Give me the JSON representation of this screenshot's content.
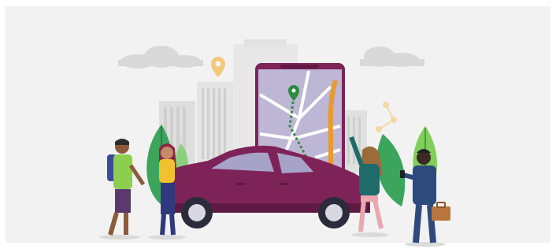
{
  "scene": {
    "description_tag": "ride-share-illustration",
    "colors": {
      "panel": "#f2f2f2",
      "car": "#7e2358",
      "car_dark": "#5e1a43",
      "phone_screen": "#bcb5d2",
      "phone_frame": "#7e2358",
      "route_green": "#2e8b3e",
      "route_orange": "#e89a2c",
      "leaf": "#3ba55c",
      "building": "#dcdcdc",
      "cloud": "#d6d6d6",
      "pin": "#f2c879"
    },
    "icons": [
      "map-pin-icon",
      "location-marker-icon",
      "briefcase-icon",
      "cloud-icon"
    ]
  }
}
